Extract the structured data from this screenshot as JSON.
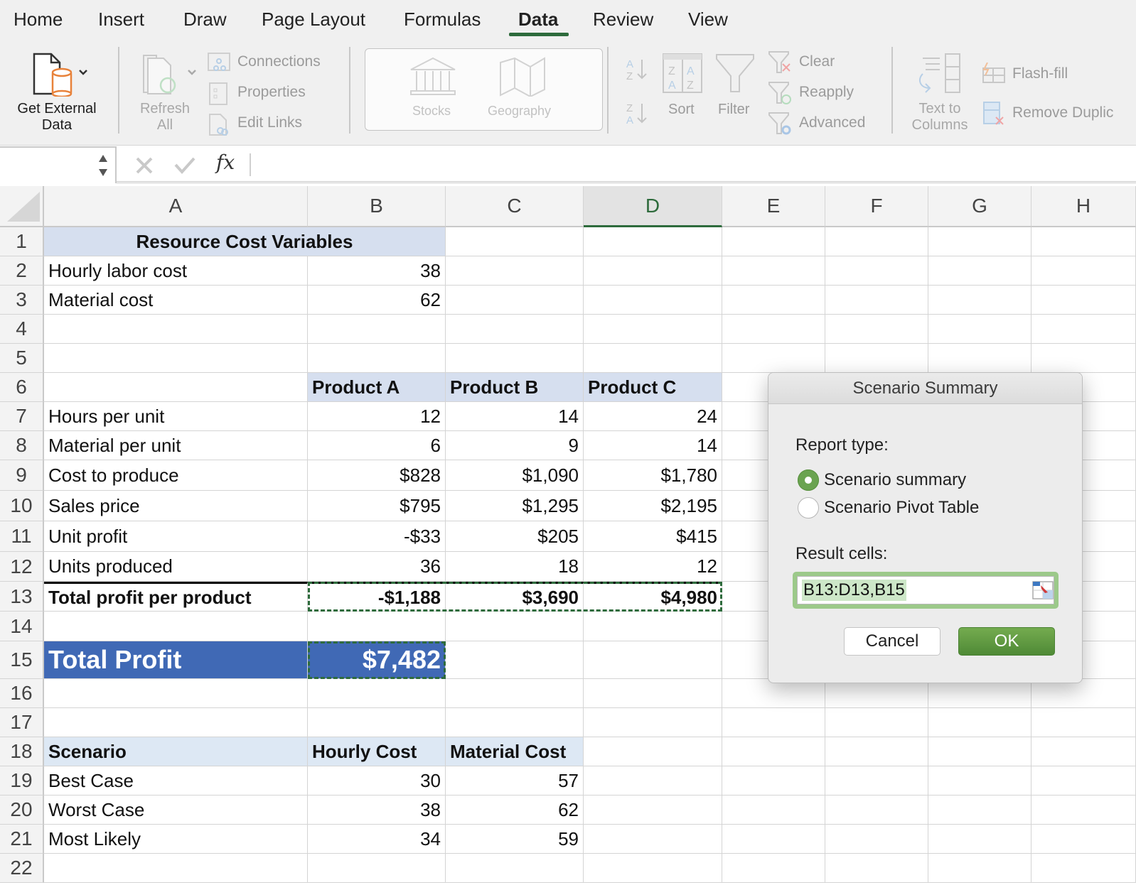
{
  "ribbon": {
    "tabs": [
      {
        "label": "Home",
        "active": false
      },
      {
        "label": "Insert",
        "active": false
      },
      {
        "label": "Draw",
        "active": false
      },
      {
        "label": "Page Layout",
        "active": false
      },
      {
        "label": "Formulas",
        "active": false
      },
      {
        "label": "Data",
        "active": true
      },
      {
        "label": "Review",
        "active": false
      },
      {
        "label": "View",
        "active": false
      }
    ],
    "get_external_data": {
      "line1": "Get External",
      "line2": "Data"
    },
    "refresh_all": {
      "line1": "Refresh",
      "line2": "All"
    },
    "connections": "Connections",
    "properties": "Properties",
    "edit_links": "Edit Links",
    "stocks": "Stocks",
    "geography": "Geography",
    "sort": "Sort",
    "filter": "Filter",
    "clear": "Clear",
    "reapply": "Reapply",
    "advanced": "Advanced",
    "text_to_columns": {
      "line1": "Text to",
      "line2": "Columns"
    },
    "flash_fill": "Flash-fill",
    "remove_duplicates": "Remove Duplic",
    "accent_color": "#2e6b3c"
  },
  "formula_bar": {
    "name_box": "",
    "fx": "fx",
    "formula": ""
  },
  "grid": {
    "columns": [
      "A",
      "B",
      "C",
      "D",
      "E",
      "F",
      "G",
      "H"
    ],
    "selected_column": "D",
    "rows": [
      "1",
      "2",
      "3",
      "4",
      "5",
      "6",
      "7",
      "8",
      "9",
      "10",
      "11",
      "12",
      "13",
      "14",
      "15",
      "16",
      "17",
      "18",
      "19",
      "20",
      "21",
      "22"
    ],
    "cells": {
      "A1": "Resource Cost Variables",
      "A2": "Hourly labor cost",
      "B2": "38",
      "A3": "Material cost",
      "B3": "62",
      "B6": "Product A",
      "C6": "Product B",
      "D6": "Product C",
      "A7": "Hours per unit",
      "B7": "12",
      "C7": "14",
      "D7": "24",
      "A8": "Material per unit",
      "B8": "6",
      "C8": "9",
      "D8": "14",
      "A9": "Cost to produce",
      "B9": "$828",
      "C9": "$1,090",
      "D9": "$1,780",
      "A10": "Sales price",
      "B10": "$795",
      "C10": "$1,295",
      "D10": "$2,195",
      "A11": "Unit profit",
      "B11": "-$33",
      "C11": "$205",
      "D11": "$415",
      "A12": "Units produced",
      "B12": "36",
      "C12": "18",
      "D12": "12",
      "A13": "Total profit per product",
      "B13": "-$1,188",
      "C13": "$3,690",
      "D13": "$4,980",
      "A15": "Total Profit",
      "B15": "$7,482",
      "A18": "Scenario",
      "B18": "Hourly Cost",
      "C18": "Material Cost",
      "A19": "Best Case",
      "B19": "30",
      "C19": "57",
      "A20": "Worst Case",
      "B20": "38",
      "C20": "62",
      "A21": "Most Likely",
      "B21": "34",
      "C21": "59"
    },
    "colors": {
      "header_fill": "#d6dfef",
      "scenario_header_fill": "#dde8f4",
      "total_profit_fill": "#4069b5",
      "marquee": "#2e6b3c"
    }
  },
  "dialog": {
    "title": "Scenario Summary",
    "report_type_label": "Report type:",
    "options": [
      {
        "label": "Scenario summary",
        "selected": true
      },
      {
        "label": "Scenario Pivot Table",
        "selected": false
      }
    ],
    "result_cells_label": "Result cells:",
    "result_cells_value": "B13:D13,B15",
    "cancel_label": "Cancel",
    "ok_label": "OK"
  }
}
